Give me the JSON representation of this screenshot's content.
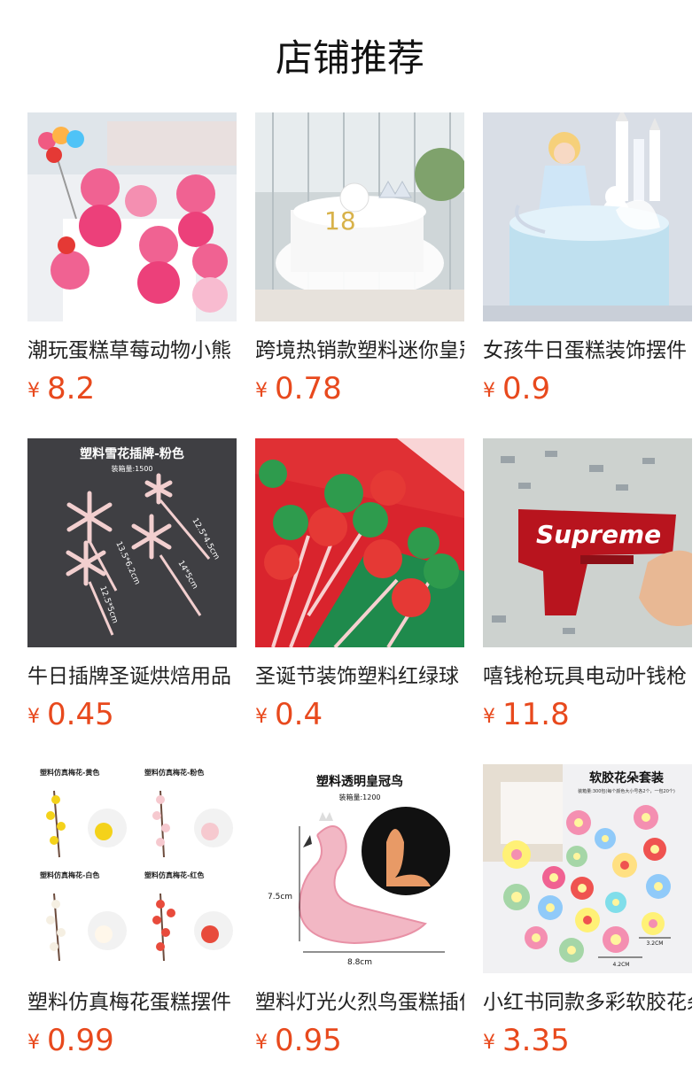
{
  "section_title": "店铺推荐",
  "currency_symbol": "¥",
  "products": [
    {
      "name": "潮玩蛋糕草莓动物小熊",
      "price": "8.2",
      "image": "strawberry-bear-cake-toppers",
      "image_text": []
    },
    {
      "name": "跨境热销款塑料迷你皇冠",
      "price": "0.78",
      "image": "crown-number-18-cake",
      "image_text": [
        "18"
      ]
    },
    {
      "name": "女孩牛日蛋糕装饰摆件",
      "price": "0.9",
      "image": "princess-castle-cake",
      "image_text": []
    },
    {
      "name": "牛日插牌圣诞烘焙用品",
      "price": "0.45",
      "image": "snowflake-picks",
      "image_text": [
        "塑料雪花插牌-粉色",
        "装箱量:1500",
        "12.5*4.5cm",
        "13.5*6.2cm",
        "14*5cm",
        "12.5*5cm"
      ]
    },
    {
      "name": "圣诞节装饰塑料红绿球",
      "price": "0.4",
      "image": "red-green-ball-picks",
      "image_text": []
    },
    {
      "name": "嘻钱枪玩具电动叶钱枪",
      "price": "11.8",
      "image": "money-gun-toy",
      "image_text": [
        "Supreme"
      ]
    },
    {
      "name": "塑料仿真梅花蛋糕摆件",
      "price": "0.99",
      "image": "plum-blossom-branches",
      "image_text": [
        "塑料仿真梅花-黄色",
        "塑料仿真梅花-粉色",
        "塑料仿真梅花-白色",
        "塑料仿真梅花-红色"
      ]
    },
    {
      "name": "塑料灯光火烈鸟蛋糕插件",
      "price": "0.95",
      "image": "clear-flamingo",
      "image_text": [
        "塑料透明皇冠鸟",
        "装箱量:1200",
        "7.5cm",
        "8.8cm"
      ]
    },
    {
      "name": "小红书同款多彩软胶花朵",
      "price": "3.35",
      "image": "soft-rubber-flowers",
      "image_text": [
        "软胶花朵套装",
        "装箱量:300包(每个颜色大小号各2个，一包20个)",
        "3.2CM",
        "4.2CM"
      ]
    }
  ]
}
